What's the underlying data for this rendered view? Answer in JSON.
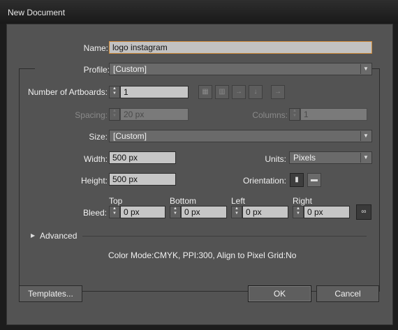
{
  "window": {
    "title": "New Document"
  },
  "form": {
    "name_label": "Name:",
    "name_value": "logo instagram",
    "profile_label": "Profile:",
    "profile_value": "[Custom]",
    "artboards_label": "Number of Artboards:",
    "artboards_value": "1",
    "spacing_label": "Spacing:",
    "spacing_value": "20 px",
    "columns_label": "Columns:",
    "columns_value": "1",
    "size_label": "Size:",
    "size_value": "[Custom]",
    "width_label": "Width:",
    "width_value": "500 px",
    "units_label": "Units:",
    "units_value": "Pixels",
    "height_label": "Height:",
    "height_value": "500 px",
    "orientation_label": "Orientation:",
    "bleed_label": "Bleed:",
    "bleed": {
      "top_label": "Top",
      "top_value": "0 px",
      "bottom_label": "Bottom",
      "bottom_value": "0 px",
      "left_label": "Left",
      "left_value": "0 px",
      "right_label": "Right",
      "right_value": "0 px"
    },
    "advanced_label": "Advanced",
    "summary": "Color Mode:CMYK, PPI:300, Align to Pixel Grid:No"
  },
  "buttons": {
    "templates": "Templates...",
    "ok": "OK",
    "cancel": "Cancel"
  },
  "icons": {
    "artboard_layout": [
      "grid-by-row-icon",
      "grid-by-column-icon",
      "arrange-by-row-icon",
      "arrange-by-column-icon",
      "right-to-left-icon"
    ],
    "orientation": [
      "portrait-icon",
      "landscape-icon"
    ],
    "link": "chain-link-icon",
    "disclosure": "triangle-right-icon"
  }
}
